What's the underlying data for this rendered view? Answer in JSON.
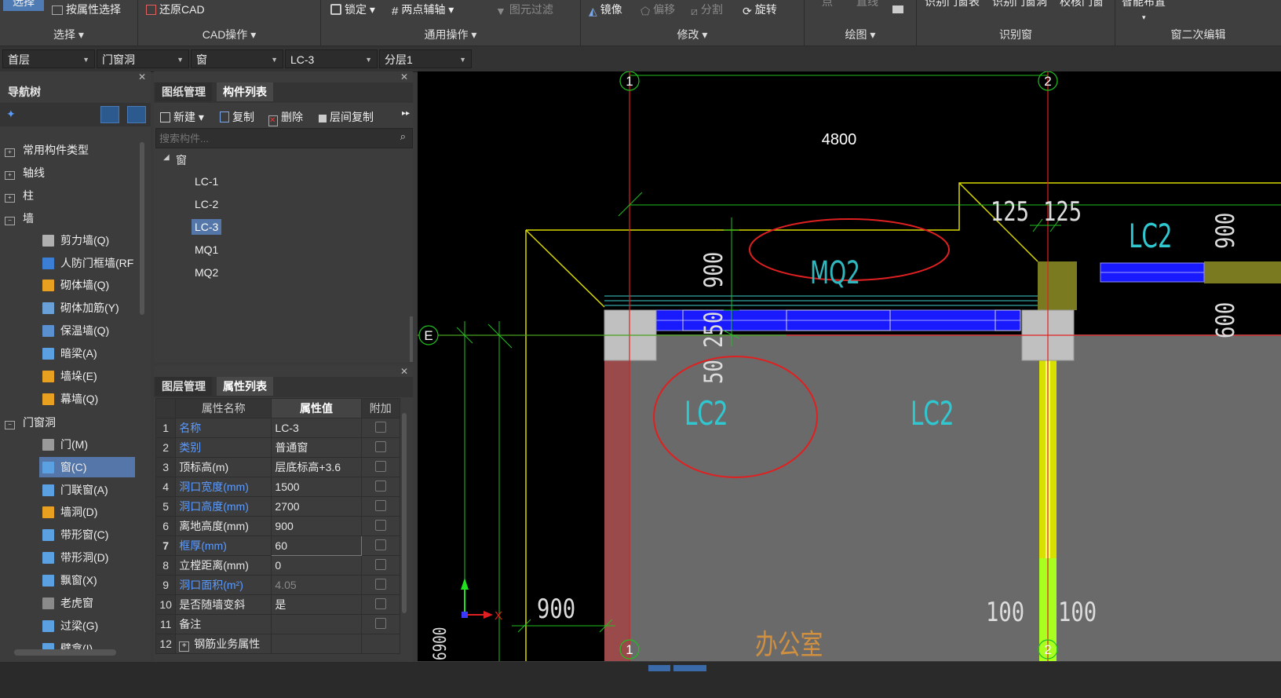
{
  "ribbon": {
    "groups": {
      "select": "选择",
      "cad": "CAD操作",
      "common": "通用操作",
      "modify": "修改",
      "draw": "绘图",
      "recognize": "识别窗",
      "secondary": "窗二次编辑"
    },
    "buttons": {
      "select_top": "选择",
      "select_by_attr": "按属性选择",
      "restore_cad": "还原CAD",
      "lock": "锁定",
      "two_point_axis": "两点辅轴",
      "element_filter": "图元过滤",
      "mirror": "镜像",
      "offset": "偏移",
      "split": "分割",
      "rotate": "旋转",
      "point": "点",
      "line": "直线",
      "rec1": "识别门窗表",
      "rec2": "识别门窗洞",
      "rec3": "校核门窗",
      "smart": "智能布置"
    }
  },
  "selectors": [
    "首层",
    "门窗洞",
    "窗",
    "LC-3",
    "分层1"
  ],
  "nav": {
    "title": "导航树",
    "items": [
      {
        "label": "常用构件类型",
        "level": 0
      },
      {
        "label": "轴线",
        "level": 0
      },
      {
        "label": "柱",
        "level": 0
      },
      {
        "label": "墙",
        "level": 0
      },
      {
        "label": "剪力墙(Q)",
        "level": 1,
        "color": "#b0b0b0"
      },
      {
        "label": "人防门框墙(RF",
        "level": 1,
        "color": "#3a7fd5"
      },
      {
        "label": "砌体墙(Q)",
        "level": 1,
        "color": "#e8a020"
      },
      {
        "label": "砌体加筋(Y)",
        "level": 1,
        "color": "#6aa0d8"
      },
      {
        "label": "保温墙(Q)",
        "level": 1,
        "color": "#5a8fd0"
      },
      {
        "label": "暗梁(A)",
        "level": 1,
        "color": "#5ba0e0"
      },
      {
        "label": "墙垛(E)",
        "level": 1,
        "color": "#e8a020"
      },
      {
        "label": "幕墙(Q)",
        "level": 1,
        "color": "#e8a020"
      },
      {
        "label": "门窗洞",
        "level": 0
      },
      {
        "label": "门(M)",
        "level": 1,
        "color": "#9a9a9a"
      },
      {
        "label": "窗(C)",
        "level": 1,
        "color": "#5ba0e0",
        "selected": true
      },
      {
        "label": "门联窗(A)",
        "level": 1,
        "color": "#5ba0e0"
      },
      {
        "label": "墙洞(D)",
        "level": 1,
        "color": "#e8a020"
      },
      {
        "label": "带形窗(C)",
        "level": 1,
        "color": "#5ba0e0"
      },
      {
        "label": "带形洞(D)",
        "level": 1,
        "color": "#5ba0e0"
      },
      {
        "label": "飘窗(X)",
        "level": 1,
        "color": "#5ba0e0"
      },
      {
        "label": "老虎窗",
        "level": 1,
        "color": "#8a8a8a"
      },
      {
        "label": "过梁(G)",
        "level": 1,
        "color": "#5ba0e0"
      },
      {
        "label": "壁龛(I)",
        "level": 1,
        "color": "#5ba0e0"
      }
    ]
  },
  "components": {
    "tabs": [
      "图纸管理",
      "构件列表"
    ],
    "toolbar": {
      "new": "新建",
      "copy": "复制",
      "delete": "删除",
      "floor_copy": "层间复制"
    },
    "search_placeholder": "搜索构件...",
    "group": "窗",
    "items": [
      "LC-1",
      "LC-2",
      "LC-3",
      "MQ1",
      "MQ2"
    ],
    "selected": "LC-3"
  },
  "properties": {
    "tabs": [
      "图层管理",
      "属性列表"
    ],
    "headers": {
      "name": "属性名称",
      "value": "属性值",
      "extra": "附加"
    },
    "rows": [
      {
        "no": "1",
        "name": "名称",
        "value": "LC-3",
        "blue": true
      },
      {
        "no": "2",
        "name": "类别",
        "value": "普通窗",
        "blue": true
      },
      {
        "no": "3",
        "name": "顶标高(m)",
        "value": "层底标高+3.6"
      },
      {
        "no": "4",
        "name": "洞口宽度(mm)",
        "value": "1500",
        "blue": true
      },
      {
        "no": "5",
        "name": "洞口高度(mm)",
        "value": "2700",
        "blue": true
      },
      {
        "no": "6",
        "name": "离地高度(mm)",
        "value": "900"
      },
      {
        "no": "7",
        "name": "框厚(mm)",
        "value": "60",
        "blue": true,
        "editing": true
      },
      {
        "no": "8",
        "name": "立樘距离(mm)",
        "value": "0"
      },
      {
        "no": "9",
        "name": "洞口面积(m²)",
        "value": "4.05",
        "blue": true,
        "gray_value": true
      },
      {
        "no": "10",
        "name": "是否随墙变斜",
        "value": "是"
      },
      {
        "no": "11",
        "name": "备注",
        "value": ""
      },
      {
        "no": "12",
        "name": "钢筋业务属性",
        "value": "",
        "plus": true
      }
    ]
  },
  "canvas": {
    "axis_labels": {
      "a1": "1",
      "a2": "2",
      "e": "E",
      "x": "X"
    },
    "dims": {
      "top": "4800",
      "d125a": "125",
      "d125b": "125",
      "d900v": "900",
      "d250": "250",
      "d50": "50",
      "d900h": "900",
      "d100a": "100",
      "d100b": "100",
      "d900r": "900",
      "d600r": "600",
      "d6900": "6900"
    },
    "labels": {
      "mq2": "MQ2",
      "lc2_left": "LC2",
      "lc2_mid": "LC2",
      "lc2_right": "LC2",
      "room": "办公室"
    }
  }
}
